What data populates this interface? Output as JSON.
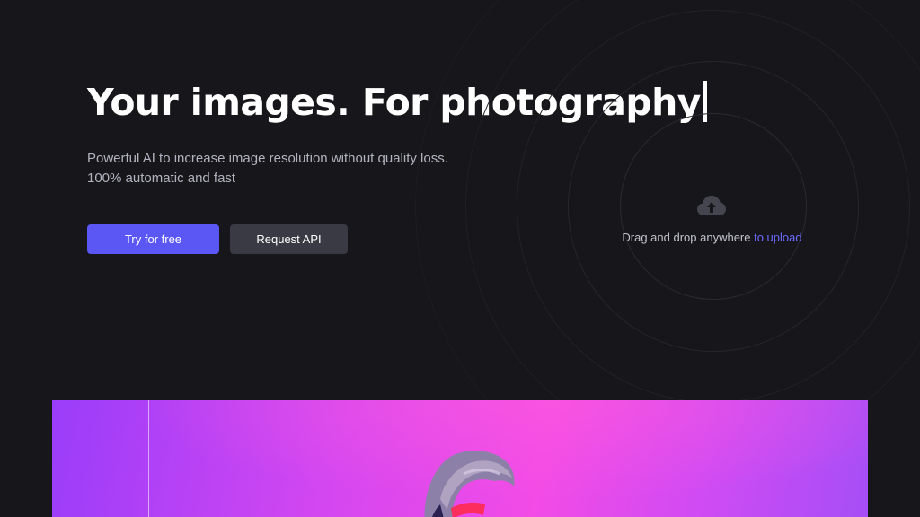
{
  "hero": {
    "headline": "Your images. For photography",
    "subtitle_line1": "Powerful AI to increase image resolution without quality loss.",
    "subtitle_line2": "100% automatic and fast"
  },
  "buttons": {
    "primary_label": "Try for free",
    "secondary_label": "Request API"
  },
  "dropzone": {
    "icon": "cloud-upload-icon",
    "text": "Drag and drop anywhere ",
    "link": "to upload"
  },
  "colors": {
    "background": "#16161b",
    "accent": "#5b57f5",
    "link": "#6d6bff",
    "secondary_button": "#3a3a45",
    "showcase_gradient_start": "#9a3dfa",
    "showcase_gradient_mid": "#f24be6"
  }
}
